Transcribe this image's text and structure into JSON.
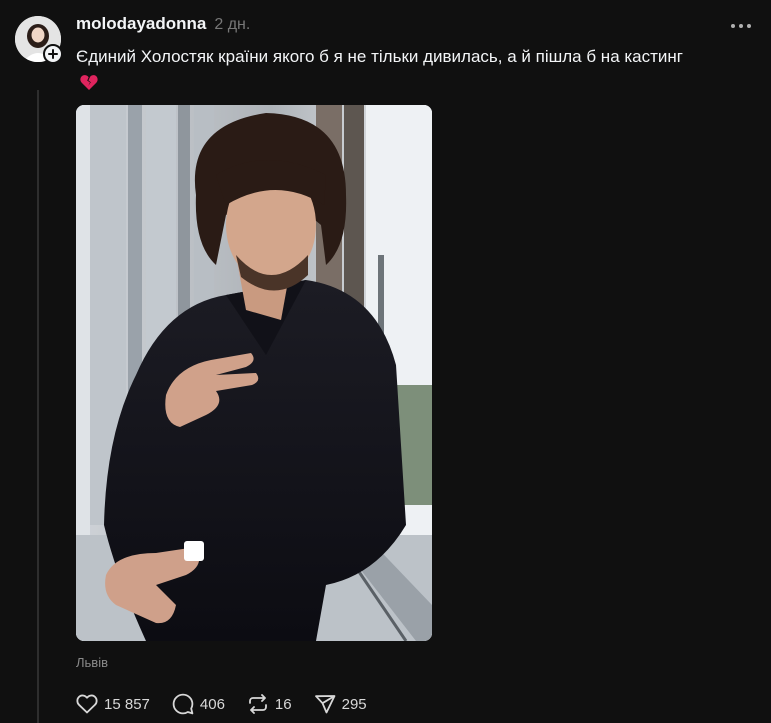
{
  "post": {
    "username": "molodayadonna",
    "time": "2 дн.",
    "caption": "Єдиний Холостяк країни якого б я не тільки дивилась, а й пішла б на кастинг",
    "location": "Львів",
    "emoji_icon": "broken-heart-icon",
    "image_alt": "photo-man-dark-shirt-balcony"
  },
  "actions": {
    "likes": "15 857",
    "replies": "406",
    "reposts": "16",
    "shares": "295"
  },
  "colors": {
    "background": "#101010",
    "text": "#f3f5f7",
    "muted": "#777777",
    "thread_line": "#2e2e2e",
    "broken_heart": "#e0245e"
  }
}
